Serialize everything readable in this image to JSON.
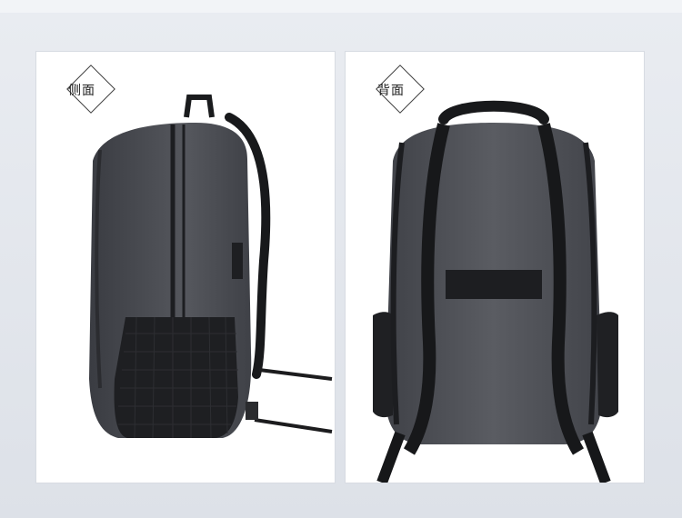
{
  "panels": [
    {
      "label": "侧面"
    },
    {
      "label": "背面"
    }
  ],
  "colors": {
    "page_background": "#e6e9ee",
    "panel_background": "#ffffff",
    "fabric": "#4a4c52",
    "strap": "#1c1c1e"
  }
}
